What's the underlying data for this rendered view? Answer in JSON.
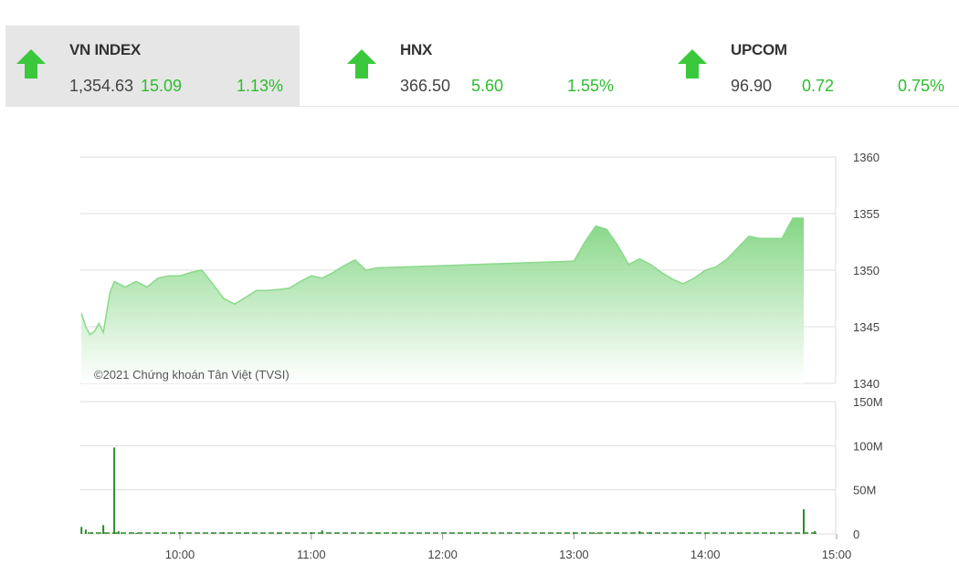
{
  "indices": [
    {
      "name": "VN INDEX",
      "value": "1,354.63",
      "change": "15.09",
      "percent": "1.13%",
      "direction": "up",
      "active": true
    },
    {
      "name": "HNX",
      "value": "366.50",
      "change": "5.60",
      "percent": "1.55%",
      "direction": "up",
      "active": false
    },
    {
      "name": "UPCOM",
      "value": "96.90",
      "change": "0.72",
      "percent": "0.75%",
      "direction": "up",
      "active": false
    }
  ],
  "colors": {
    "up": "#3cc83c",
    "line": "#7ed47e",
    "fill_top": "#8fdf8f",
    "grid": "#dddddd",
    "volume": "#2e8b2e"
  },
  "icons": {
    "trend": "arrow-up-icon"
  },
  "chart_data": [
    {
      "type": "area",
      "title": "",
      "watermark": "©2021 Chứng khoán Tân Việt (TVSI)",
      "y_axis_side": "right",
      "ylim": [
        1340,
        1360
      ],
      "yticks": [
        "1360",
        "1355",
        "1350",
        "1345",
        "1340"
      ],
      "ytick_values": [
        1360,
        1355,
        1350,
        1345,
        1340
      ],
      "series": [
        {
          "x": [
            "09:15",
            "09:17",
            "09:19",
            "09:21",
            "09:23",
            "09:25",
            "09:28",
            "09:30",
            "09:35",
            "09:40",
            "09:45",
            "09:50",
            "09:55",
            "10:00",
            "10:05",
            "10:10",
            "10:15",
            "10:20",
            "10:25",
            "10:30",
            "10:35",
            "10:40",
            "10:45",
            "10:50",
            "10:55",
            "11:00",
            "11:05",
            "11:10",
            "11:15",
            "11:20",
            "11:25",
            "11:30",
            "13:00",
            "13:05",
            "13:10",
            "13:15",
            "13:20",
            "13:25",
            "13:30",
            "13:35",
            "13:40",
            "13:45",
            "13:50",
            "13:55",
            "14:00",
            "14:05",
            "14:10",
            "14:15",
            "14:20",
            "14:25",
            "14:30",
            "14:35",
            "14:40",
            "14:45"
          ],
          "values": [
            1346.2,
            1345.0,
            1344.3,
            1344.6,
            1345.3,
            1344.5,
            1348.0,
            1349.0,
            1348.5,
            1349.0,
            1348.5,
            1349.3,
            1349.5,
            1349.5,
            1349.8,
            1350.0,
            1348.8,
            1347.5,
            1347.0,
            1347.6,
            1348.2,
            1348.2,
            1348.3,
            1348.4,
            1349.0,
            1349.5,
            1349.3,
            1349.8,
            1350.4,
            1350.9,
            1350.0,
            1350.2,
            1350.8,
            1352.5,
            1353.9,
            1353.6,
            1352.2,
            1350.5,
            1351.0,
            1350.5,
            1349.8,
            1349.2,
            1348.8,
            1349.3,
            1350.0,
            1350.3,
            1351.0,
            1352.0,
            1353.0,
            1352.8,
            1352.8,
            1352.8,
            1354.6,
            1354.6
          ]
        }
      ]
    },
    {
      "type": "bar",
      "title": "",
      "y_axis_side": "right",
      "ylim": [
        0,
        150
      ],
      "yticks": [
        "150M",
        "100M",
        "50M",
        "0"
      ],
      "ytick_values": [
        150,
        100,
        50,
        0
      ],
      "xticks": [
        "10:00",
        "11:00",
        "12:00",
        "13:00",
        "14:00",
        "15:00"
      ],
      "series": [
        {
          "x": [
            "09:15",
            "09:17",
            "09:20",
            "09:25",
            "09:30",
            "09:32",
            "09:40",
            "09:50",
            "10:00",
            "10:15",
            "10:20",
            "10:30",
            "10:45",
            "11:00",
            "11:05",
            "11:30",
            "13:00",
            "13:10",
            "13:20",
            "13:30",
            "13:35",
            "13:50",
            "14:00",
            "14:15",
            "14:30",
            "14:45",
            "14:50"
          ],
          "values": [
            8,
            5,
            2,
            10,
            98,
            3,
            1,
            1,
            2,
            1,
            2,
            1,
            1,
            2,
            4,
            1,
            2,
            1,
            1,
            3,
            2,
            1,
            1,
            1,
            1,
            28,
            3
          ]
        }
      ]
    }
  ]
}
